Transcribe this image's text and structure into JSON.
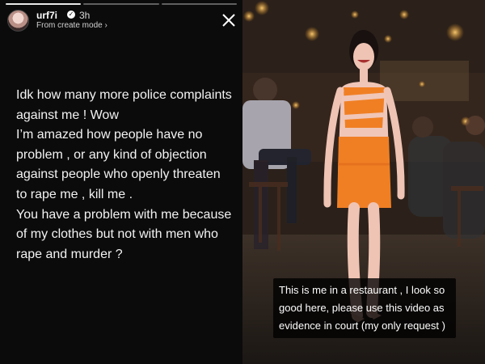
{
  "story": {
    "username": "urf7i",
    "verified_icon": "verified-badge-icon",
    "timestamp": "3h",
    "subtitle": "From create mode",
    "subtitle_chevron": "›",
    "close_icon": "close-icon",
    "progress_segments": 3,
    "progress_active_segment": 1,
    "text_lines": [
      "Idk how many more police complaints",
      "against me ! Wow",
      "I’m amazed how people have no",
      "problem , or any kind of objection",
      "against people who openly threaten",
      "to rape me , kill me .",
      "You have a problem with me because",
      "of my clothes but not with men who",
      "rape and murder ?"
    ]
  },
  "video": {
    "caption_lines": [
      "This is me in a restaurant ,  I look so",
      "good here, please use this video as",
      "evidence in court (my only request )"
    ]
  },
  "colors": {
    "story_background": "#0b0b0b",
    "text": "#f3f3f3",
    "dress": "#f07f24"
  }
}
